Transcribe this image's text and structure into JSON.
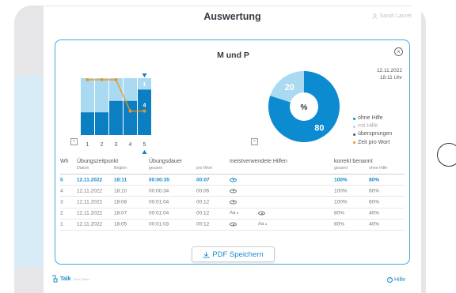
{
  "app": {
    "title": "Auswertung",
    "user_name": "Sarah Lauret"
  },
  "modal": {
    "title": "M und P",
    "close_icon": "×",
    "date": "12.11.2022",
    "time": "18:11 Uhr"
  },
  "bar_chart": {
    "type": "stacked-bar-with-line",
    "x_labels": [
      "1",
      "2",
      "3",
      "4",
      "5"
    ],
    "selected_index": 4,
    "selected_bar_labels": {
      "top": "1",
      "mid": "4"
    },
    "nav_prev": "<",
    "nav_next": ">",
    "series_fractions": {
      "ohne_hilfe": [
        0.4,
        0.4,
        0.6,
        0.6,
        0.8
      ],
      "mit_hilfe": [
        0.6,
        0.6,
        0.4,
        0.4,
        0.2
      ]
    },
    "line_values_relative": [
      1.0,
      1.0,
      1.0,
      0.45,
      0.45
    ]
  },
  "pie": {
    "center_label": "%",
    "values": [
      {
        "label": "ohne Hilfe",
        "value": 80,
        "color": "#0c8bd1"
      },
      {
        "label": "mit Hilfe",
        "value": 20,
        "color": "#a9daf1"
      }
    ]
  },
  "legend": [
    {
      "label": "ohne Hilfe",
      "color": "#0c8bd1"
    },
    {
      "label": "mit Hilfe",
      "color": "#a9daf1"
    },
    {
      "label": "übersprungen",
      "color": "#555555"
    },
    {
      "label": "Zeit pro Wort",
      "color": "#f39414"
    }
  ],
  "colors": {
    "accent": "#1a8acd",
    "bar_dark": "#0c7fc2",
    "bar_light": "#a9daf1",
    "line": "#f39414"
  },
  "table": {
    "headers": {
      "wh": "Wh",
      "uebungszeitpunkt": "Übungszeitpunkt",
      "datum": "Datum",
      "beginn": "Beginn",
      "uebungsdauer": "Übungsdauer",
      "gesamt": "gesamt",
      "pro_wort": "pro Wort",
      "hilfen": "meistverwendete Hilfen",
      "korrekt": "korrekt benannt",
      "k_gesamt": "gesamt",
      "k_ohne": "ohne Hilfe"
    },
    "rows": [
      {
        "wh": "5",
        "datum": "12.11.2022",
        "beginn": "18:11",
        "gesamt": "00:00:35",
        "pro_wort": "00:07",
        "hilfe1": "eye",
        "hilfe2": "",
        "k_gesamt": "100%",
        "k_ohne": "80%",
        "current": true
      },
      {
        "wh": "4",
        "datum": "12.11.2022",
        "beginn": "18:10",
        "gesamt": "00:00:34",
        "pro_wort": "00:06",
        "hilfe1": "eye",
        "hilfe2": "",
        "k_gesamt": "100%",
        "k_ohne": "60%",
        "current": false
      },
      {
        "wh": "3",
        "datum": "12.11.2022",
        "beginn": "18:08",
        "gesamt": "00:01:04",
        "pro_wort": "00:12",
        "hilfe1": "eye",
        "hilfe2": "",
        "k_gesamt": "100%",
        "k_ohne": "60%",
        "current": false
      },
      {
        "wh": "2",
        "datum": "12.11.2022",
        "beginn": "18:07",
        "gesamt": "00:01:04",
        "pro_wort": "00:12",
        "hilfe1": "Aa",
        "hilfe2": "eye",
        "k_gesamt": "80%",
        "k_ohne": "40%",
        "current": false
      },
      {
        "wh": "1",
        "datum": "12.11.2022",
        "beginn": "18:05",
        "gesamt": "00:01:03",
        "pro_wort": "00:12",
        "hilfe1": "eye",
        "hilfe2": "Aa",
        "k_gesamt": "80%",
        "k_ohne": "40%",
        "current": false
      }
    ]
  },
  "pdf_button": {
    "label": "PDF Speichern",
    "icon": "download-icon"
  },
  "footer": {
    "logo": "Talk",
    "small_text": "Click Editor",
    "help": "Hilfe",
    "help_icon": "?"
  }
}
